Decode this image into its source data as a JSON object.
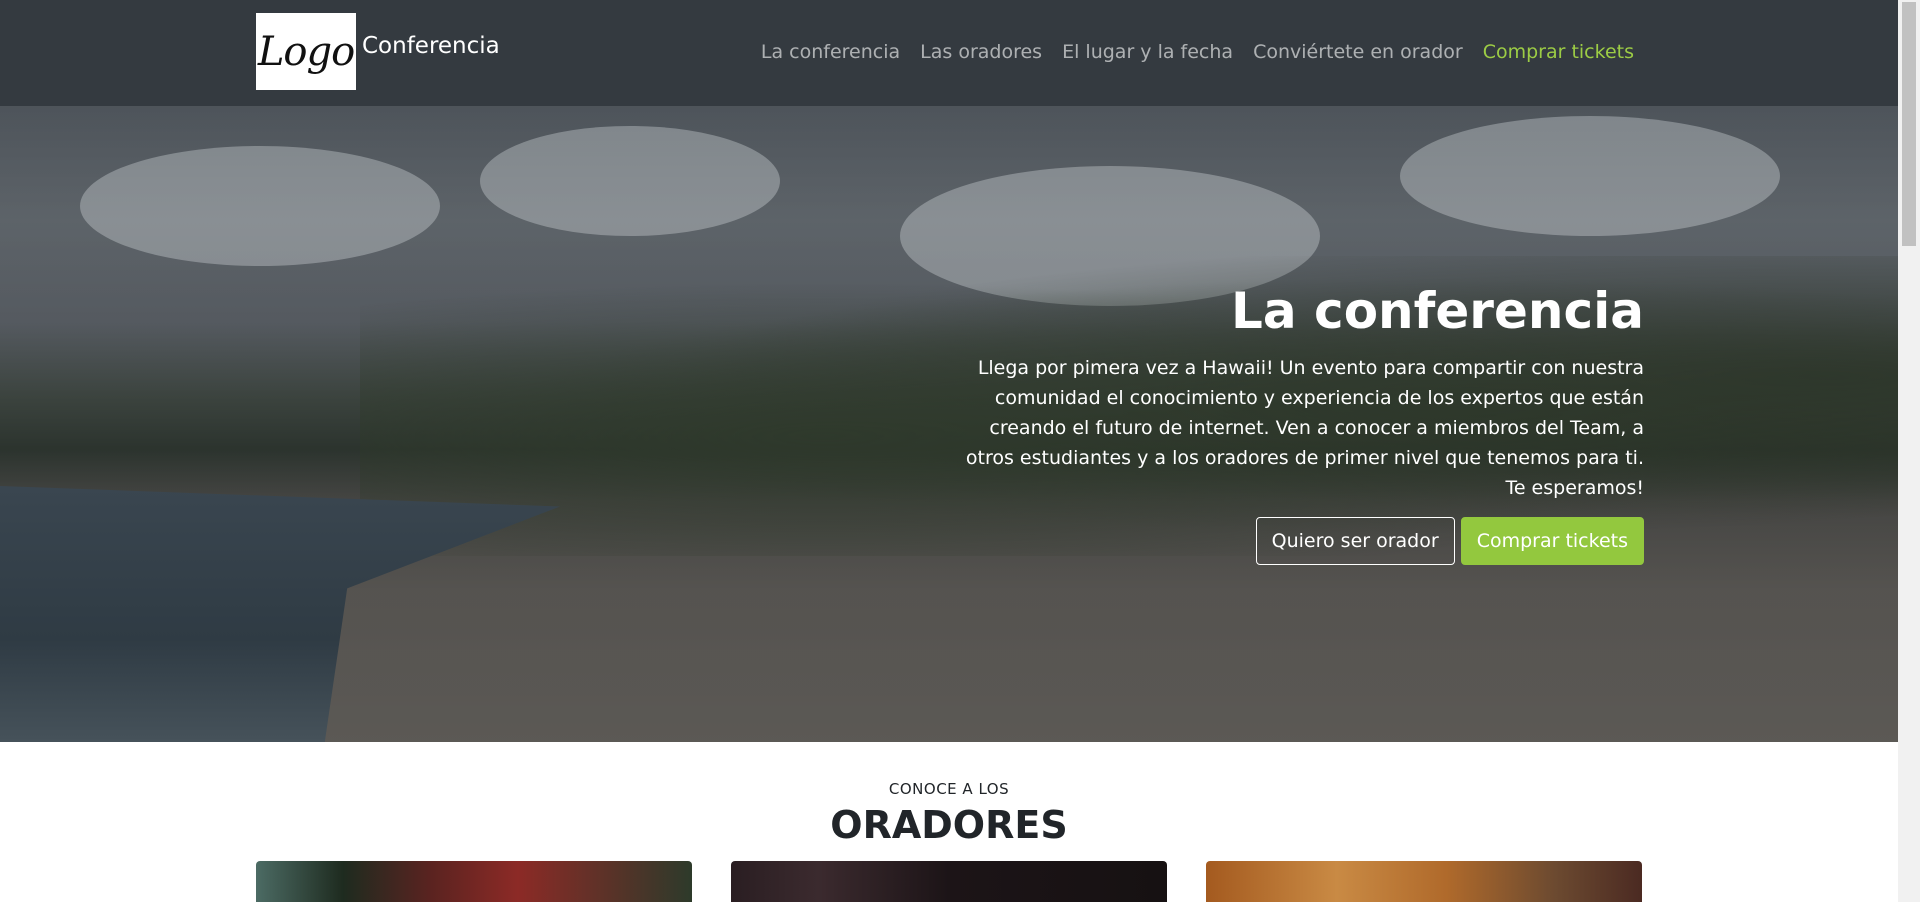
{
  "navbar": {
    "logo_text": "Logo",
    "brand": "Conferencia",
    "links": [
      {
        "label": "La conferencia"
      },
      {
        "label": "Las oradores"
      },
      {
        "label": "El lugar y la fecha"
      },
      {
        "label": "Conviértete en orador"
      },
      {
        "label": "Comprar tickets"
      }
    ]
  },
  "hero": {
    "title": "La conferencia",
    "text": "Llega por pimera vez a Hawaii! Un evento para compartir con nuestra comunidad el conocimiento y experiencia de los expertos que están creando el futuro de internet. Ven a conocer a miembros del Team, a otros estudiantes y a los oradores de primer nivel que tenemos para ti. Te esperamos!",
    "button_speaker": "Quiero ser orador",
    "button_tickets": "Comprar tickets"
  },
  "speakers": {
    "kicker": "CONOCE A LOS",
    "title": "ORADORES"
  },
  "colors": {
    "navbar_bg": "#343a40",
    "accent_green": "#93c83e",
    "nav_active_green": "#9ccc45"
  }
}
